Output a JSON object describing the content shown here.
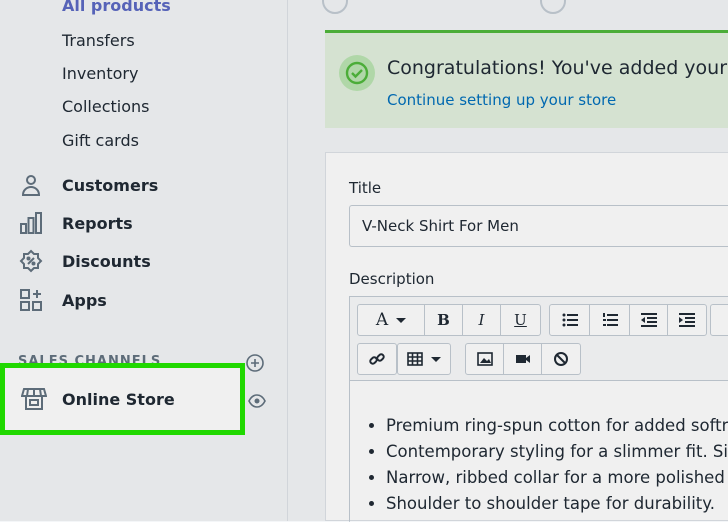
{
  "sidebar": {
    "sub_items": [
      "All products",
      "Transfers",
      "Inventory",
      "Collections",
      "Gift cards"
    ],
    "nav": [
      {
        "label": "Customers",
        "icon": "person-icon"
      },
      {
        "label": "Reports",
        "icon": "bar-chart-icon"
      },
      {
        "label": "Discounts",
        "icon": "discount-badge-icon"
      },
      {
        "label": "Apps",
        "icon": "apps-grid-icon"
      }
    ],
    "sales_channels_label": "SALES CHANNELS",
    "online_store_label": "Online Store"
  },
  "banner": {
    "title": "Congratulations! You've added your firs",
    "link": "Continue setting up your store"
  },
  "product": {
    "title_label": "Title",
    "title_value": "V-Neck Shirt For Men",
    "description_label": "Description",
    "bullets": [
      "Premium ring-spun cotton for added softn",
      "Contemporary styling for a slimmer fit. Siz",
      "Narrow, ribbed collar for a more polished",
      "Shoulder to shoulder tape for durability."
    ]
  },
  "toolbar": {
    "font_label": "A",
    "bold_label": "B",
    "italic_label": "I",
    "underline_label": "U"
  },
  "colors": {
    "highlight": "#22e600",
    "banner_bg": "#e3f1df",
    "link": "#006fbb"
  }
}
